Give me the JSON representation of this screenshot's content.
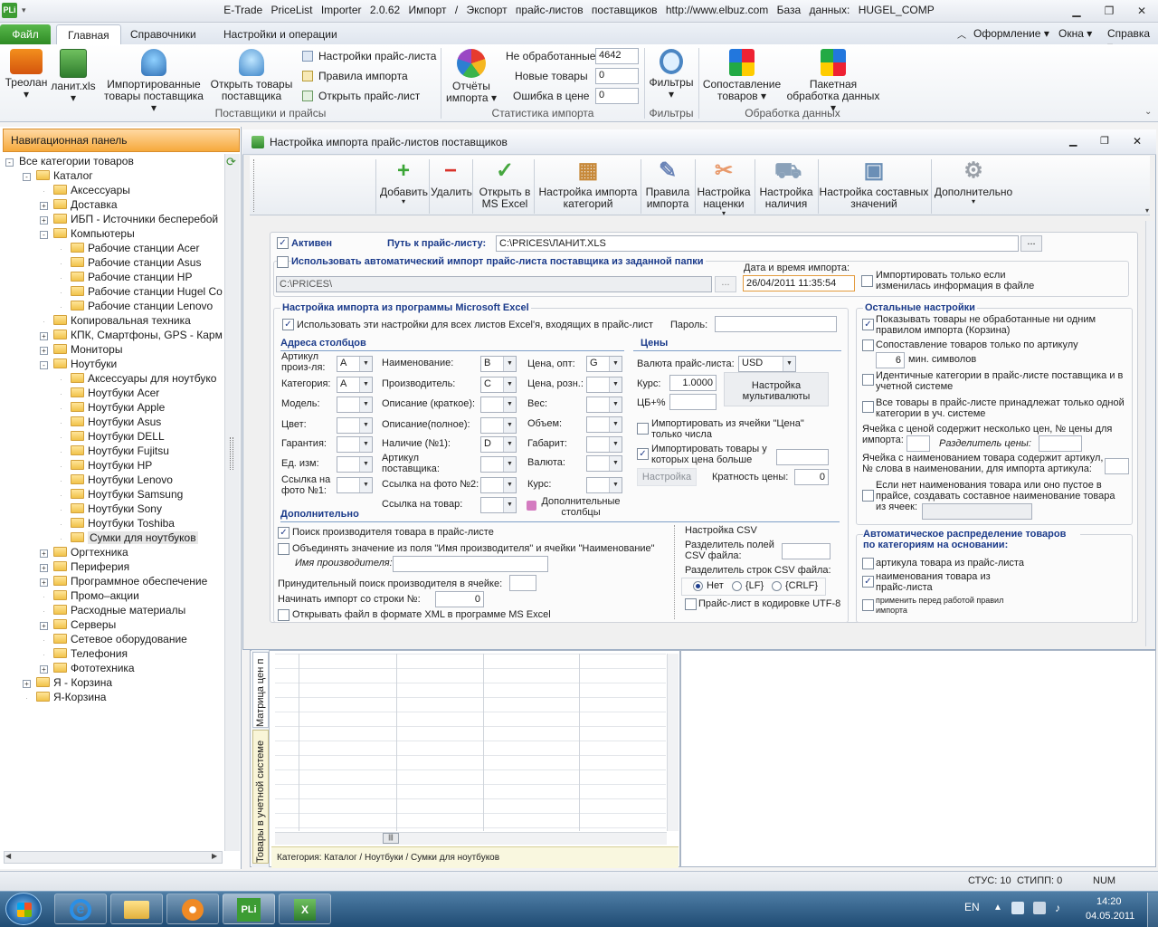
{
  "window": {
    "app_icon": "PLi",
    "title": "E-Trade PriceList Importer 2.0.62    Импорт / Экспорт прайс-листов поставщиков    http://www.elbuz.com    База данных: HUGEL_COMP"
  },
  "menu": {
    "file": "Файл",
    "tabs": [
      "Главная",
      "Справочники",
      "Настройки и операции"
    ],
    "right": [
      "Оформление",
      "Окна",
      "Справка"
    ]
  },
  "ribbon": {
    "btn_treolan": "Треолан",
    "btn_lanit": "ланит.xls",
    "btn_imported_1": "Импортированные",
    "btn_imported_2": "товары поставщика",
    "btn_open_1": "Открыть товары",
    "btn_open_2": "поставщика",
    "link_settings": "Настройки прайс-листа",
    "link_rules": "Правила импорта",
    "link_open": "Открыть прайс-лист",
    "group_suppliers": "Поставщики и прайсы",
    "btn_reports_1": "Отчёты",
    "btn_reports_2": "импорта",
    "stat_unprocessed_label": "Не обработанные",
    "stat_unprocessed": "4642",
    "stat_new_label": "Новые товары",
    "stat_new": "0",
    "stat_err_label": "Ошибка в цене",
    "stat_err": "0",
    "group_stats": "Статистика импорта",
    "btn_filters": "Фильтры",
    "group_filters": "Фильтры",
    "btn_match_1": "Сопоставление",
    "btn_match_2": "товаров",
    "btn_batch_1": "Пакетная",
    "btn_batch_2": "обработка данных",
    "group_data": "Обработка данных"
  },
  "nav": {
    "header": "Навигационная панель",
    "tree": [
      {
        "label": "Все категории товаров",
        "level": 0,
        "pm": "-"
      },
      {
        "label": "Каталог",
        "level": 1,
        "pm": "-"
      },
      {
        "label": "Аксессуары",
        "level": 2,
        "pm": ""
      },
      {
        "label": "Доставка",
        "level": 2,
        "pm": "+"
      },
      {
        "label": "ИБП - Источники бесперебой",
        "level": 2,
        "pm": "+"
      },
      {
        "label": "Компьютеры",
        "level": 2,
        "pm": "-"
      },
      {
        "label": "Рабочие станции Acer",
        "level": 3,
        "pm": ""
      },
      {
        "label": "Рабочие станции Asus",
        "level": 3,
        "pm": ""
      },
      {
        "label": "Рабочие станции HP",
        "level": 3,
        "pm": ""
      },
      {
        "label": "Рабочие станции Hugel Co",
        "level": 3,
        "pm": ""
      },
      {
        "label": "Рабочие станции Lenovo",
        "level": 3,
        "pm": ""
      },
      {
        "label": "Копировальная техника",
        "level": 2,
        "pm": ""
      },
      {
        "label": "КПК, Смартфоны, GPS - Карм",
        "level": 2,
        "pm": "+"
      },
      {
        "label": "Мониторы",
        "level": 2,
        "pm": "+"
      },
      {
        "label": "Ноутбуки",
        "level": 2,
        "pm": "-"
      },
      {
        "label": "Аксессуары для ноутбуко",
        "level": 3,
        "pm": ""
      },
      {
        "label": "Ноутбуки Acer",
        "level": 3,
        "pm": ""
      },
      {
        "label": "Ноутбуки Apple",
        "level": 3,
        "pm": ""
      },
      {
        "label": "Ноутбуки Asus",
        "level": 3,
        "pm": ""
      },
      {
        "label": "Ноутбуки DELL",
        "level": 3,
        "pm": ""
      },
      {
        "label": "Ноутбуки Fujitsu",
        "level": 3,
        "pm": ""
      },
      {
        "label": "Ноутбуки HP",
        "level": 3,
        "pm": ""
      },
      {
        "label": "Ноутбуки Lenovo",
        "level": 3,
        "pm": ""
      },
      {
        "label": "Ноутбуки Samsung",
        "level": 3,
        "pm": ""
      },
      {
        "label": "Ноутбуки Sony",
        "level": 3,
        "pm": ""
      },
      {
        "label": "Ноутбуки Toshiba",
        "level": 3,
        "pm": ""
      },
      {
        "label": "Сумки для ноутбуков",
        "level": 3,
        "pm": "",
        "selected": true
      },
      {
        "label": "Оргтехника",
        "level": 2,
        "pm": "+"
      },
      {
        "label": "Периферия",
        "level": 2,
        "pm": "+"
      },
      {
        "label": "Программное обеспечение",
        "level": 2,
        "pm": "+"
      },
      {
        "label": "Промо–акции",
        "level": 2,
        "pm": ""
      },
      {
        "label": "Расходные материалы",
        "level": 2,
        "pm": ""
      },
      {
        "label": "Серверы",
        "level": 2,
        "pm": "+"
      },
      {
        "label": "Сетевое оборудование",
        "level": 2,
        "pm": ""
      },
      {
        "label": "Телефония",
        "level": 2,
        "pm": ""
      },
      {
        "label": "Фототехника",
        "level": 2,
        "pm": "+"
      },
      {
        "label": "Я - Корзина",
        "level": 1,
        "pm": "+"
      },
      {
        "label": "Я-Корзина",
        "level": 1,
        "pm": ""
      }
    ]
  },
  "child": {
    "title": "Настройка импорта прайс-листов поставщиков",
    "toolbar": [
      {
        "label": "Добавить",
        "sub": "",
        "icon": "plus-icon"
      },
      {
        "label": "Удалить",
        "sub": "",
        "icon": "minus-icon"
      },
      {
        "label": "Открыть в",
        "sub": "MS Excel",
        "icon": "check-icon"
      },
      {
        "label": "Настройка импорта",
        "sub": "категорий",
        "icon": "category-icon"
      },
      {
        "label": "Правила",
        "sub": "импорта",
        "icon": "quill-icon"
      },
      {
        "label": "Настройка",
        "sub": "наценки",
        "icon": "markup-icon"
      },
      {
        "label": "Настройка",
        "sub": "наличия",
        "icon": "cart-icon"
      },
      {
        "label": "Настройка составных",
        "sub": "значений",
        "icon": "composite-icon"
      },
      {
        "label": "Дополнительно",
        "sub": "",
        "icon": "gear-icon"
      }
    ]
  },
  "form": {
    "active_label": "Активен",
    "path_label": "Путь к прайс-листу:",
    "path_value": "C:\\PRICES\\ЛАНИТ.XLS",
    "browse": "...",
    "auto_import_label": "Использовать автоматический импорт прайс-листа поставщика из заданной папки",
    "auto_path": "C:\\PRICES\\",
    "date_label": "Дата и время импорта:",
    "date_value": "26/04/2011 11:35:54",
    "only_changed": "Импортировать только если изменилась информация в файле",
    "excel_title": "Настройка импорта из программы Microsoft Excel",
    "excel_all_sheets": "Использовать эти настройки для всех листов Excel'я, входящих в прайс-лист",
    "password_label": "Пароль:",
    "columns_title": "Адреса столбцов",
    "col_article": "Артикул произ-ля:",
    "col_article_v": "A",
    "col_category": "Категория:",
    "col_category_v": "A",
    "col_model": "Модель:",
    "col_color": "Цвет:",
    "col_warranty": "Гарантия:",
    "col_unit": "Ед. изм:",
    "col_photo1": "Ссылка на фото №1:",
    "col_name": "Наименование:",
    "col_name_v": "B",
    "col_vendor": "Производитель:",
    "col_vendor_v": "C",
    "col_desc_short": "Описание (краткое):",
    "col_desc_full": "Описание(полное):",
    "col_stock": "Наличие (№1):",
    "col_stock_v": "D",
    "col_supplier_article": "Артикул поставщика:",
    "col_photo2": "Ссылка на фото №2:",
    "col_link": "Ссылка на товар:",
    "col_price_opt": "Цена, опт:",
    "col_price_opt_v": "G",
    "col_price_retail": "Цена, розн.:",
    "col_weight": "Вес:",
    "col_volume": "Объем:",
    "col_size": "Габарит:",
    "col_currency": "Валюта:",
    "col_rate": "Курс:",
    "extra_columns": "Дополнительные столбцы",
    "prices_title": "Цены",
    "price_currency_label": "Валюта прайс-листа:",
    "price_currency": "USD",
    "rate_label": "Курс:",
    "rate_value": "1.0000",
    "cb_label": "ЦБ+%",
    "multi_currency": "Настройка мультивалюты",
    "price_numbers_only": "Импортировать из ячейки \"Цена\" только числа",
    "price_greater": "Импортировать товары у которых цена больше чем:",
    "setup_btn": "Настройка",
    "multiplicity_label": "Кратность цены:",
    "multiplicity": "0",
    "extra_title": "Дополнительно",
    "vendor_search": "Поиск производителя товара в прайс-листе",
    "merge_vendor": "Объединять значение из поля \"Имя производителя\" и ячейки \"Наименование\"",
    "vendor_name_label": "Имя производителя:",
    "forced_vendor": "Принудительный поиск производителя в ячейке:",
    "start_row_label": "Начинать импорт со строки №:",
    "start_row": "0",
    "xml_open": "Открывать файл в формате XML в программе MS Excel",
    "csv_title": "Настройка CSV",
    "csv_field_sep": "Разделитель полей CSV файла:",
    "csv_row_sep": "Разделитель строк CSV файла:",
    "csv_no": "Нет",
    "csv_lf": "{LF}",
    "csv_crlf": "{CRLF}",
    "csv_utf8": "Прайс-лист в кодировке UTF-8",
    "other_title": "Остальные настройки",
    "o1": "Показывать товары не обработанные ни одним правилом импорта (Корзина)",
    "o2": "Сопоставление товаров только по артикулу",
    "o2_min": "6",
    "o2_min_label": "мин. символов",
    "o3": "Идентичные категории в прайс-листе поставщика и в учетной системе",
    "o4": "Все товары в прайс-листе принадлежат только одной категории в уч. системе",
    "o5": "Ячейка с ценой содержит несколько цен, № цены для импорта:",
    "o5_sep": "Разделитель цены:",
    "o6": "Ячейка с наименованием товара содержит артикул, № слова в наименовании, для импорта артикула:",
    "o7": "Если нет наименования товара или оно пустое в прайсе, создавать составное наименование товара из ячеек:",
    "auto_title": "Автоматическое распределение товаров по категориям на основании:",
    "a1": "артикула товара из прайс-листа",
    "a2": "наименования товара из прайс-листа",
    "a3": "применить перед работой правил импорта"
  },
  "grid": {
    "tab1": "Матрица цен п",
    "tab2": "Товары в учетной системе",
    "status": "Категория: Каталог / Ноутбуки / Сумки для ноутбуков"
  },
  "statusbar": {
    "stus": "СТУС: 10",
    "stipp": "СТИПП: 0",
    "num": "NUM"
  },
  "taskbar": {
    "lang": "EN",
    "time": "14:20",
    "date": "04.05.2011"
  }
}
